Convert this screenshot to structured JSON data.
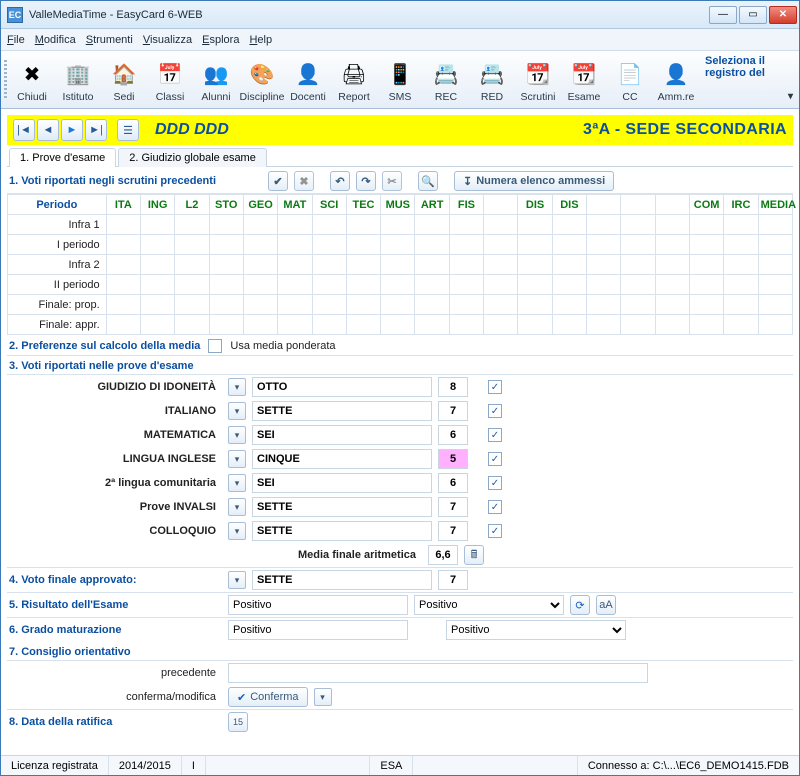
{
  "window": {
    "title": "ValleMediaTime - EasyCard 6-WEB",
    "app_abbrev": "EC"
  },
  "menu": {
    "file": "File",
    "modifica": "Modifica",
    "strumenti": "Strumenti",
    "visualizza": "Visualizza",
    "esplora": "Esplora",
    "help": "Help"
  },
  "toolbar": {
    "items": [
      {
        "label": "Chiudi",
        "emoji": "✖"
      },
      {
        "label": "Istituto",
        "emoji": "🏢"
      },
      {
        "label": "Sedi",
        "emoji": "🏠"
      },
      {
        "label": "Classi",
        "emoji": "📅"
      },
      {
        "label": "Alunni",
        "emoji": "👥"
      },
      {
        "label": "Discipline",
        "emoji": "🎨"
      },
      {
        "label": "Docenti",
        "emoji": "👤"
      },
      {
        "label": "Report",
        "emoji": "🖨"
      },
      {
        "label": "SMS",
        "emoji": "📱"
      },
      {
        "label": "REC",
        "emoji": "📇"
      },
      {
        "label": "RED",
        "emoji": "📇"
      },
      {
        "label": "Scrutini",
        "emoji": "📆"
      },
      {
        "label": "Esame",
        "emoji": "📆"
      },
      {
        "label": "CC",
        "emoji": "📄"
      },
      {
        "label": "Amm.re",
        "emoji": "👤"
      }
    ],
    "selector_label": "Seleziona il registro del"
  },
  "nav": {
    "student": "DDD DDD",
    "class": "3ªA - SEDE SECONDARIA"
  },
  "tabs": {
    "t1": "1. Prove d'esame",
    "t2": "2. Giudizio globale esame"
  },
  "section1": {
    "title": "1. Voti riportati negli scrutini precedenti",
    "numera": "Numera elenco ammessi"
  },
  "grid": {
    "periodo": "Periodo",
    "cols": [
      "ITA",
      "ING",
      "L2",
      "STO",
      "GEO",
      "MAT",
      "SCI",
      "TEC",
      "MUS",
      "ART",
      "FIS",
      "",
      "DIS",
      "DIS",
      "",
      "",
      "",
      "COM",
      "IRC",
      "MEDIA"
    ],
    "rows": [
      "Infra 1",
      "I periodo",
      "Infra 2",
      "II periodo",
      "Finale: prop.",
      "Finale: appr."
    ]
  },
  "section2": {
    "title": "2. Preferenze sul calcolo della media",
    "chk_label": "Usa media ponderata"
  },
  "section3": {
    "title": "3. Voti riportati nelle prove d'esame",
    "rows": [
      {
        "label": "GIUDIZIO DI IDONEITÀ",
        "word": "OTTO",
        "num": "8",
        "checked": true
      },
      {
        "label": "ITALIANO",
        "word": "SETTE",
        "num": "7",
        "checked": true
      },
      {
        "label": "MATEMATICA",
        "word": "SEI",
        "num": "6",
        "checked": true
      },
      {
        "label": "LINGUA INGLESE",
        "word": "CINQUE",
        "num": "5",
        "checked": true,
        "pink": true
      },
      {
        "label": "2ª lingua comunitaria",
        "word": "SEI",
        "num": "6",
        "checked": true
      },
      {
        "label": "Prove INVALSI",
        "word": "SETTE",
        "num": "7",
        "checked": true
      },
      {
        "label": "COLLOQUIO",
        "word": "SETTE",
        "num": "7",
        "checked": true
      }
    ],
    "media_label": "Media finale aritmetica",
    "media_value": "6,6"
  },
  "section4": {
    "title": "4. Voto finale approvato:",
    "word": "SETTE",
    "num": "7"
  },
  "section5": {
    "title": "5. Risultato dell'Esame",
    "val1": "Positivo",
    "val2": "Positivo"
  },
  "section6": {
    "title": "6. Grado maturazione",
    "val1": "Positivo",
    "val2": "Positivo"
  },
  "section7": {
    "title": "7. Consiglio orientativo",
    "precedente_label": "precedente",
    "conferma_label": "conferma/modifica",
    "conferma_btn": "Conferma"
  },
  "section8": {
    "title": "8. Data della ratifica"
  },
  "status": {
    "lic": "Licenza registrata",
    "anno": "2014/2015",
    "tipo": "I",
    "modo": "ESA",
    "conn": "Connesso a: C:\\...\\EC6_DEMO1415.FDB"
  }
}
